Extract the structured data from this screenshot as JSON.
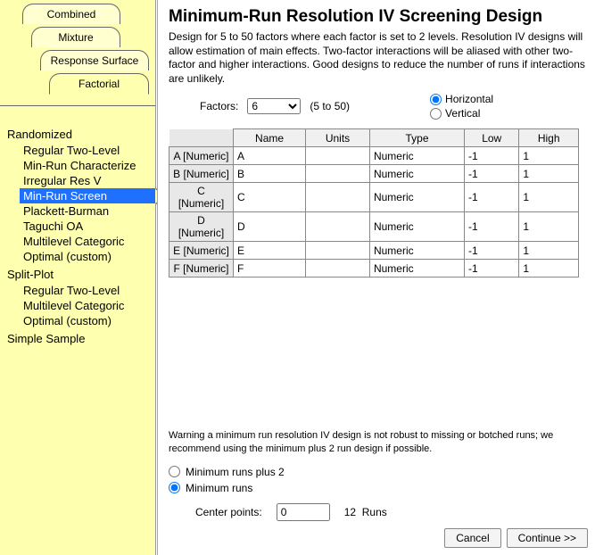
{
  "sidebar": {
    "tabs": {
      "combined": "Combined",
      "mixture": "Mixture",
      "response": "Response Surface",
      "factorial": "Factorial"
    },
    "groups": [
      {
        "label": "Randomized",
        "items": [
          "Regular Two-Level",
          "Min-Run Characterize",
          "Irregular Res V",
          "Min-Run Screen",
          "Plackett-Burman",
          "Taguchi OA",
          "Multilevel Categoric",
          "Optimal (custom)"
        ],
        "selected_index": 3
      },
      {
        "label": "Split-Plot",
        "items": [
          "Regular Two-Level",
          "Multilevel Categoric",
          "Optimal (custom)"
        ],
        "selected_index": -1
      },
      {
        "label": "Simple Sample",
        "items": [],
        "selected_index": -1
      }
    ]
  },
  "main": {
    "title": "Minimum-Run Resolution IV Screening Design",
    "desc": "Design for 5 to 50 factors where each factor is set to 2 levels. Resolution IV designs will allow estimation of main effects. Two-factor interactions will be aliased with other two-factor and higher interactions. Good designs to reduce the number of runs if interactions are unlikely.",
    "factors_label": "Factors:",
    "factors_value": "6",
    "factors_range": "(5 to 50)",
    "orientation": {
      "horizontal": "Horizontal",
      "vertical": "Vertical",
      "selected": "horizontal"
    },
    "columns": [
      "Name",
      "Units",
      "Type",
      "Low",
      "High"
    ],
    "rows": [
      {
        "head": "A [Numeric]",
        "name": "A",
        "units": "",
        "type": "Numeric",
        "low": "-1",
        "high": "1"
      },
      {
        "head": "B [Numeric]",
        "name": "B",
        "units": "",
        "type": "Numeric",
        "low": "-1",
        "high": "1"
      },
      {
        "head": "C [Numeric]",
        "name": "C",
        "units": "",
        "type": "Numeric",
        "low": "-1",
        "high": "1"
      },
      {
        "head": "D [Numeric]",
        "name": "D",
        "units": "",
        "type": "Numeric",
        "low": "-1",
        "high": "1"
      },
      {
        "head": "E [Numeric]",
        "name": "E",
        "units": "",
        "type": "Numeric",
        "low": "-1",
        "high": "1"
      },
      {
        "head": "F [Numeric]",
        "name": "F",
        "units": "",
        "type": "Numeric",
        "low": "-1",
        "high": "1"
      }
    ],
    "warning": "Warning a minimum run resolution IV design is not robust to missing or botched runs; we recommend using the minimum plus 2 run design if possible.",
    "run_options": {
      "plus2": "Minimum runs plus 2",
      "min": "Minimum runs",
      "selected": "min"
    },
    "center_label": "Center points:",
    "center_value": "0",
    "runs_count": "12",
    "runs_label": "Runs",
    "cancel": "Cancel",
    "continue": "Continue >>"
  }
}
